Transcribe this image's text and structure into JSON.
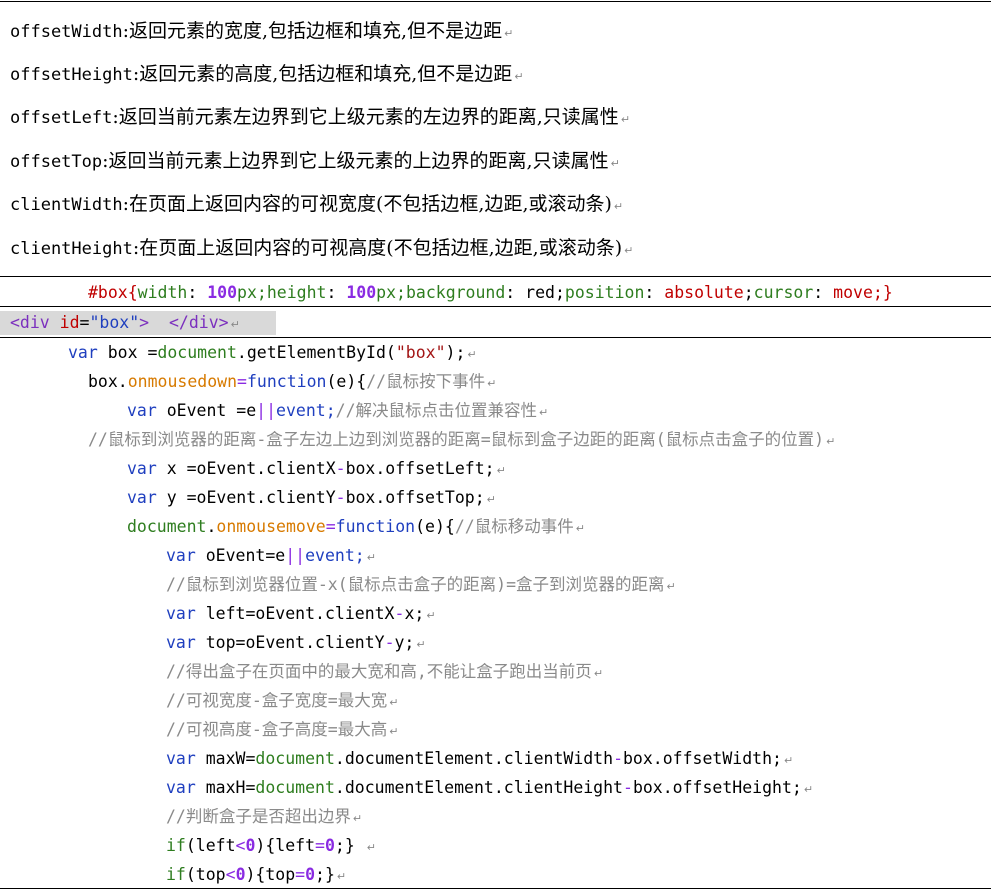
{
  "definitions": [
    {
      "key": "offsetWidth",
      "desc": ":返回元素的宽度,包括边框和填充,但不是边距"
    },
    {
      "key": "offsetHeight",
      "desc": ":返回元素的高度,包括边框和填充,但不是边距"
    },
    {
      "key": "offsetLeft",
      "desc": ":返回当前元素左边界到它上级元素的左边界的距离,只读属性"
    },
    {
      "key": "offsetTop",
      "desc": ":返回当前元素上边界到它上级元素的上边界的距离,只读属性"
    },
    {
      "key": "clientWidth",
      "desc": ":在页面上返回内容的可视宽度(不包括边框,边距,或滚动条)"
    },
    {
      "key": "clientHeight",
      "desc": ":在页面上返回内容的可视高度(不包括边框,边距,或滚动条)"
    }
  ],
  "paragraph_mark": "↵",
  "css_line": {
    "selector": "#box{",
    "p1": "width",
    "v1": "100",
    "u1": "px;",
    "p2": "height",
    "v2": "100",
    "u2": "px;",
    "p3": "background",
    "v3": " red;",
    "p4": "position",
    "v4": " absolute",
    "p5": "cursor",
    "v5": " move",
    "end": ";}"
  },
  "html_line": {
    "tag_open": "<div ",
    "attr": "id",
    "eq": "=",
    "val": "\"box\"",
    "close": ">  </div>"
  },
  "js": {
    "l1": {
      "kw": "var",
      "a": " box =",
      "doc": "document",
      "b": ".getElementById(",
      "str": "\"box\"",
      "c": ");"
    },
    "l2": {
      "a": "box.",
      "prop": "onmousedown",
      "eq": "=",
      "fn": "function",
      "b": "(e){",
      "com": "//鼠标按下事件"
    },
    "l3": {
      "kw": "var",
      "a": " oEvent =e",
      "op": "||",
      "b": "event;",
      "com": "//解决鼠标点击位置兼容性"
    },
    "l4": {
      "com": "//鼠标到浏览器的距离-盒子左边上边到浏览器的距离=鼠标到盒子边距的距离(鼠标点击盒子的位置)"
    },
    "l5": {
      "kw": "var",
      "a": " x =oEvent.clientX",
      "op": "-",
      "b": "box.offsetLeft;"
    },
    "l6": {
      "kw": "var",
      "a": " y =oEvent.clientY",
      "op": "-",
      "b": "box.offsetTop;"
    },
    "l7": {
      "doc": "document",
      "a": ".",
      "prop": "onmousemove",
      "eq": "=",
      "fn": "function",
      "b": "(e){",
      "com": "//鼠标移动事件"
    },
    "l8": {
      "kw": "var",
      "a": " oEvent=e",
      "op": "||",
      "b": "event;"
    },
    "l9": {
      "com": "//鼠标到浏览器位置-x(鼠标点击盒子的距离)=盒子到浏览器的距离"
    },
    "l10": {
      "kw": "var",
      "a": " left=oEvent.clientX",
      "op": "-",
      "b": "x;"
    },
    "l11": {
      "kw": "var",
      "a": " top=oEvent.clientY",
      "op": "-",
      "b": "y;"
    },
    "l12": {
      "com": "//得出盒子在页面中的最大宽和高,不能让盒子跑出当前页"
    },
    "l13": {
      "com": "//可视宽度-盒子宽度=最大宽"
    },
    "l14": {
      "com": "//可视高度-盒子高度=最大高"
    },
    "l15": {
      "kw": "var",
      "a": " maxW=",
      "doc": "document",
      "b": ".documentElement.clientWidth",
      "op": "-",
      "c": "box.offsetWidth;"
    },
    "l16": {
      "kw": "var",
      "a": " maxH=",
      "doc": "document",
      "b": ".documentElement.clientHeight",
      "op": "-",
      "c": "box.offsetHeight;"
    },
    "l17": {
      "com": "//判断盒子是否超出边界"
    },
    "l18": {
      "kw": "if",
      "a": "(left",
      "op": "<",
      "num": "0",
      "b": "){left",
      "eq": "=",
      "num2": "0",
      "c": ";} "
    },
    "l19": {
      "kw": "if",
      "a": "(top",
      "op": "<",
      "num": "0",
      "b": "){top",
      "eq": "=",
      "num2": "0",
      "c": ";}"
    }
  }
}
